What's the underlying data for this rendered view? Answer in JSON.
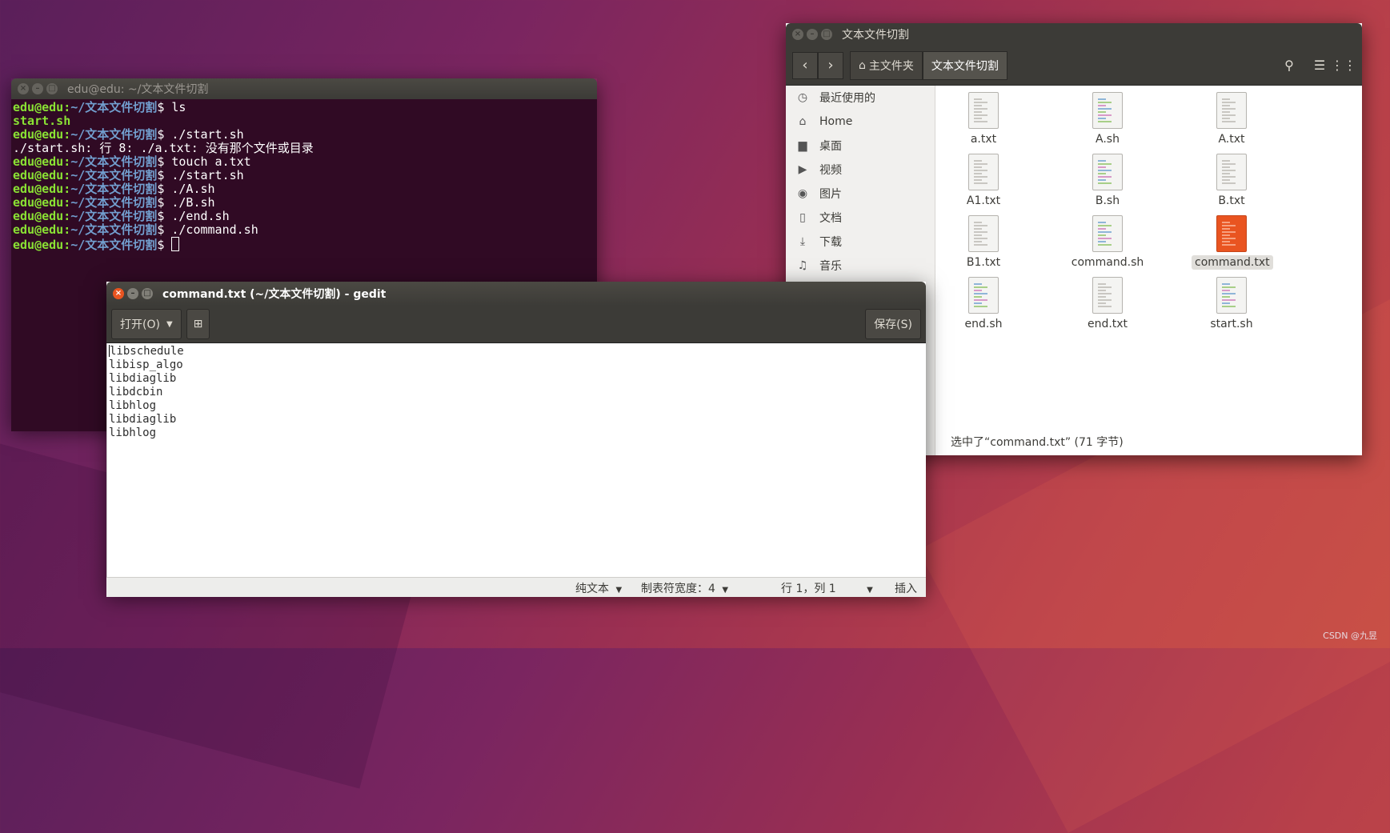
{
  "terminal": {
    "title": "edu@edu: ~/文本文件切割",
    "prompt_user": "edu@edu",
    "prompt_path": "~/文本文件切割",
    "lines": [
      {
        "kind": "cmd",
        "text": "$ ls"
      },
      {
        "kind": "green",
        "text": "start.sh"
      },
      {
        "kind": "cmd",
        "text": "$ ./start.sh"
      },
      {
        "kind": "plain",
        "text": "./start.sh: 行 8: ./a.txt: 没有那个文件或目录"
      },
      {
        "kind": "cmd",
        "text": "$ touch a.txt"
      },
      {
        "kind": "cmd",
        "text": "$ ./start.sh"
      },
      {
        "kind": "cmd",
        "text": "$ ./A.sh"
      },
      {
        "kind": "cmd",
        "text": "$ ./B.sh"
      },
      {
        "kind": "cmd",
        "text": "$ ./end.sh"
      },
      {
        "kind": "cmd",
        "text": "$ ./command.sh"
      },
      {
        "kind": "cmd",
        "text": "$ "
      }
    ]
  },
  "files": {
    "title": "文本文件切割",
    "breadcrumbs": [
      "主文件夹",
      "文本文件切割"
    ],
    "sidebar": [
      {
        "icon": "clock-icon",
        "label": "最近使用的"
      },
      {
        "icon": "home-icon",
        "label": "Home"
      },
      {
        "icon": "folder-icon",
        "label": "桌面"
      },
      {
        "icon": "video-icon",
        "label": "视频"
      },
      {
        "icon": "camera-icon",
        "label": "图片"
      },
      {
        "icon": "document-icon",
        "label": "文档"
      },
      {
        "icon": "download-icon",
        "label": "下载"
      },
      {
        "icon": "music-icon",
        "label": "音乐"
      }
    ],
    "items": [
      {
        "name": "a.txt",
        "kind": "txt"
      },
      {
        "name": "A.sh",
        "kind": "sh"
      },
      {
        "name": "A.txt",
        "kind": "txt"
      },
      {
        "name": "A1.txt",
        "kind": "txt"
      },
      {
        "name": "B.sh",
        "kind": "sh"
      },
      {
        "name": "B.txt",
        "kind": "txt"
      },
      {
        "name": "B1.txt",
        "kind": "txt"
      },
      {
        "name": "command.sh",
        "kind": "sh"
      },
      {
        "name": "command.txt",
        "kind": "txt",
        "selected": true
      },
      {
        "name": "end.sh",
        "kind": "sh"
      },
      {
        "name": "end.txt",
        "kind": "txt"
      },
      {
        "name": "start.sh",
        "kind": "sh"
      }
    ],
    "status": "选中了“command.txt” (71 字节)"
  },
  "gedit": {
    "title": "command.txt (~/文本文件切割) - gedit",
    "open_label": "打开(O)",
    "save_label": "保存(S)",
    "lines": [
      "libschedule",
      "libisp_algo",
      "libdiaglib",
      "libdcbin",
      "libhlog",
      "libdiaglib",
      "libhlog"
    ],
    "status": {
      "lang": "纯文本",
      "tab_width": "制表符宽度：4",
      "position": "行 1，列 1",
      "mode": "插入"
    }
  },
  "watermark": "CSDN @九昱",
  "colors": {
    "accent": "#e95420",
    "terminal_bg": "#300a24",
    "prompt_green": "#8ae234",
    "prompt_blue": "#729fcf"
  }
}
